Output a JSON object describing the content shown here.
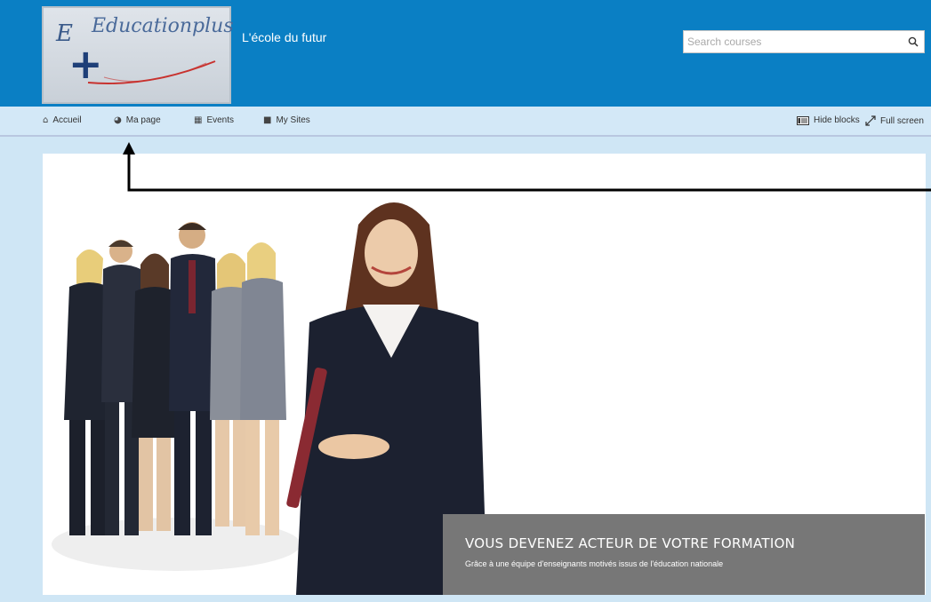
{
  "header": {
    "logo": {
      "prefix": "E",
      "name": "Educationplus",
      "plus": "+"
    },
    "site_title": "L'école du futur",
    "search": {
      "placeholder": "Search courses",
      "value": ""
    }
  },
  "nav": {
    "items": [
      {
        "label": "Accueil",
        "icon": "home-icon",
        "glyph": "⌂"
      },
      {
        "label": "Ma page",
        "icon": "dashboard-icon",
        "glyph": "◕"
      },
      {
        "label": "Events",
        "icon": "calendar-icon",
        "glyph": "▦"
      },
      {
        "label": "My Sites",
        "icon": "briefcase-icon",
        "glyph": "■"
      }
    ],
    "hide_blocks": "Hide blocks",
    "full_screen": "Full screen"
  },
  "slider": {
    "caption_title": "VOUS DEVENEZ ACTEUR DE VOTRE FORMATION",
    "caption_subtitle": "Grâce à une équipe d'enseignants motivés issus de l'éducation nationale"
  },
  "colors": {
    "header_bg": "#0a7fc4",
    "nav_bg": "#d3e8f7",
    "caption_bg": "#777777",
    "annotation": "#000000"
  }
}
